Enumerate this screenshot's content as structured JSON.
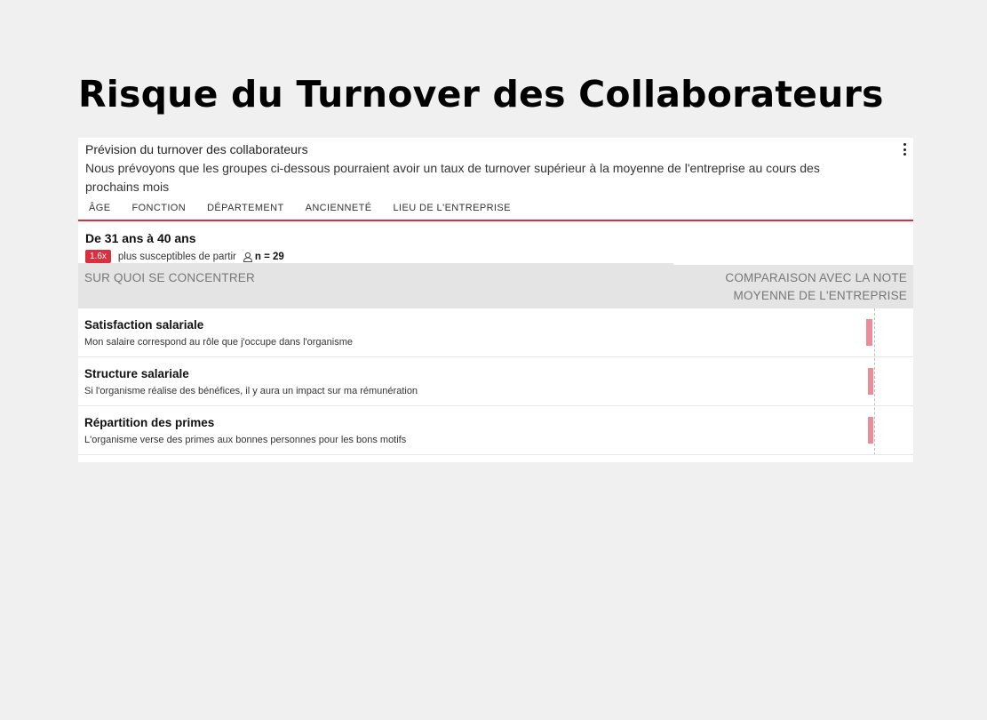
{
  "page": {
    "title": "Risque du Turnover des Collaborateurs"
  },
  "card": {
    "title": "Prévision du turnover des collaborateurs",
    "description": "Nous prévoyons que les groupes ci-dessous pourraient avoir un taux de turnover supérieur à la moyenne de l'entreprise au cours des prochains mois",
    "menu_icon": "kebab-menu-icon"
  },
  "tabs": [
    {
      "label": "ÂGE",
      "active": true
    },
    {
      "label": "FONCTION",
      "active": false
    },
    {
      "label": "DÉPARTEMENT",
      "active": false
    },
    {
      "label": "ANCIENNETÉ",
      "active": false
    },
    {
      "label": "LIEU DE L'ENTREPRISE",
      "active": false
    }
  ],
  "group": {
    "title": "De 31 ans à 40 ans",
    "badge": "1.6x",
    "likelihood_text": "plus susceptibles de partir",
    "n_label": "n = 29",
    "icon": "person-icon"
  },
  "focus": {
    "left_header": "SUR QUOI SE CONCENTRER",
    "right_header_line1": "COMPARAISON AVEC LA NOTE",
    "right_header_line2": "MOYENNE DE L'ENTREPRISE"
  },
  "items": [
    {
      "title": "Satisfaction salariale",
      "description": "Mon salaire correspond au rôle que j'occupe dans l'organisme"
    },
    {
      "title": "Structure salariale",
      "description": "Si l'organisme réalise des bénéfices, il y aura un impact sur ma rémunération"
    },
    {
      "title": "Répartition des primes",
      "description": "L'organisme verse des primes aux bonnes personnes pour les bons motifs"
    }
  ],
  "colors": {
    "accent": "#d9303f",
    "bar": "#eb8c98",
    "header_bg": "#e4e4e4",
    "page_bg": "#f0f0f0"
  }
}
